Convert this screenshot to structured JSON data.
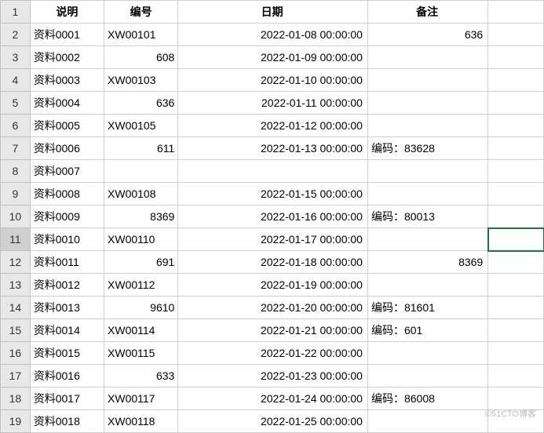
{
  "chart_data": {
    "type": "table",
    "headers": [
      "说明",
      "编号",
      "日期",
      "备注"
    ],
    "rows": [
      {
        "row_num": "1",
        "is_header": true,
        "desc": "说明",
        "code": "编号",
        "date": "日期",
        "note": "备注"
      },
      {
        "row_num": "2",
        "desc": "资料0001",
        "code": "XW00101",
        "code_is_text": true,
        "date": "2022-01-08 00:00:00",
        "note": "636",
        "note_is_text": false
      },
      {
        "row_num": "3",
        "desc": "资料0002",
        "code": "608",
        "code_is_text": false,
        "date": "2022-01-09 00:00:00",
        "note": "",
        "note_is_text": false
      },
      {
        "row_num": "4",
        "desc": "资料0003",
        "code": "XW00103",
        "code_is_text": true,
        "date": "2022-01-10 00:00:00",
        "note": "",
        "note_is_text": false
      },
      {
        "row_num": "5",
        "desc": "资料0004",
        "code": "636",
        "code_is_text": false,
        "date": "2022-01-11 00:00:00",
        "note": "",
        "note_is_text": false
      },
      {
        "row_num": "6",
        "desc": "资料0005",
        "code": "XW00105",
        "code_is_text": true,
        "date": "2022-01-12 00:00:00",
        "note": "",
        "note_is_text": false
      },
      {
        "row_num": "7",
        "desc": "资料0006",
        "code": "611",
        "code_is_text": false,
        "date": "2022-01-13 00:00:00",
        "note": "编码：83628",
        "note_is_text": true
      },
      {
        "row_num": "8",
        "desc": "资料0007",
        "code": "",
        "code_is_text": false,
        "date": "",
        "note": "",
        "note_is_text": false
      },
      {
        "row_num": "9",
        "desc": "资料0008",
        "code": "XW00108",
        "code_is_text": true,
        "date": "2022-01-15 00:00:00",
        "note": "",
        "note_is_text": false
      },
      {
        "row_num": "10",
        "desc": "资料0009",
        "code": "8369",
        "code_is_text": false,
        "date": "2022-01-16 00:00:00",
        "note": "编码：80013",
        "note_is_text": true
      },
      {
        "row_num": "11",
        "desc": "资料0010",
        "code": "XW00110",
        "code_is_text": true,
        "date": "2022-01-17 00:00:00",
        "note": "",
        "note_is_text": false,
        "selected": true
      },
      {
        "row_num": "12",
        "desc": "资料0011",
        "code": "691",
        "code_is_text": false,
        "date": "2022-01-18 00:00:00",
        "note": "8369",
        "note_is_text": false
      },
      {
        "row_num": "13",
        "desc": "资料0012",
        "code": "XW00112",
        "code_is_text": true,
        "date": "2022-01-19 00:00:00",
        "note": "",
        "note_is_text": false
      },
      {
        "row_num": "14",
        "desc": "资料0013",
        "code": "9610",
        "code_is_text": false,
        "date": "2022-01-20 00:00:00",
        "note": "编码：81601",
        "note_is_text": true
      },
      {
        "row_num": "15",
        "desc": "资料0014",
        "code": "XW00114",
        "code_is_text": true,
        "date": "2022-01-21 00:00:00",
        "note": "编码：601",
        "note_is_text": true
      },
      {
        "row_num": "16",
        "desc": "资料0015",
        "code": "XW00115",
        "code_is_text": true,
        "date": "2022-01-22 00:00:00",
        "note": "",
        "note_is_text": false
      },
      {
        "row_num": "17",
        "desc": "资料0016",
        "code": "633",
        "code_is_text": false,
        "date": "2022-01-23 00:00:00",
        "note": "",
        "note_is_text": false
      },
      {
        "row_num": "18",
        "desc": "资料0017",
        "code": "XW00117",
        "code_is_text": true,
        "date": "2022-01-24 00:00:00",
        "note": "编码：86008",
        "note_is_text": true
      },
      {
        "row_num": "19",
        "desc": "资料0018",
        "code": "XW00118",
        "code_is_text": true,
        "date": "2022-01-25 00:00:00",
        "note": "",
        "note_is_text": false
      }
    ]
  },
  "watermark": "©51CTO博客"
}
